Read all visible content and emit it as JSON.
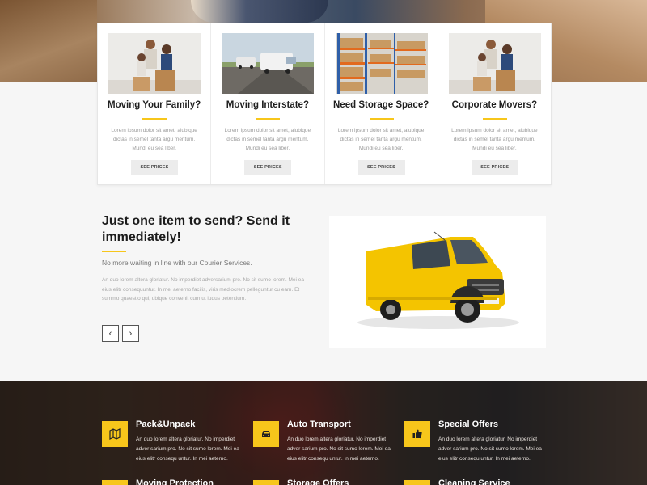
{
  "cards": [
    {
      "title": "Moving Your Family?",
      "desc": "Lorem ipsum dolor sit amet, alubique dictas in semel tanta argu mentum. Mundi eu sea liber.",
      "button": "SEE PRICES",
      "image": "family-with-boxes"
    },
    {
      "title": "Moving Interstate?",
      "desc": "Lorem ipsum dolor sit amet, alubique dictas in semel tanta argu mentum. Mundi eu sea liber.",
      "button": "SEE PRICES",
      "image": "vans-on-road"
    },
    {
      "title": "Need Storage Space?",
      "desc": "Lorem ipsum dolor sit amet, alubique dictas in semel tanta argu mentum. Mundi eu sea liber.",
      "button": "SEE PRICES",
      "image": "warehouse-shelves"
    },
    {
      "title": "Corporate Movers?",
      "desc": "Lorem ipsum dolor sit amet, alubique dictas in semel tanta argu mentum. Mundi eu sea liber.",
      "button": "SEE PRICES",
      "image": "family-with-boxes"
    }
  ],
  "intro": {
    "title": "Just one item to send? Send it immediately!",
    "subtitle": "No more waiting in line with our Courier Services.",
    "body": "An duo lorem altera gloriatur. No imperdiet adversarium pro. No sit sumo lorem. Mei ea eius elitr consequuntur. In mei aeterno facilis, viris mediocrem pelleguntur cu eam. Et summo quaestio qui, ubique convenit cum ut ludus petentium.",
    "prev_glyph": "‹",
    "next_glyph": "›"
  },
  "features": [
    {
      "title": "Pack&Unpack",
      "desc": "An duo lorem altera gloriatur. No imperdiet adver sarium pro. No sit sumo lorem. Mei ea eius elitr consequ untur. In mei aeterno.",
      "icon": "map-icon"
    },
    {
      "title": "Auto Transport",
      "desc": "An duo lorem altera gloriatur. No imperdiet adver sarium pro. No sit sumo lorem. Mei ea eius elitr consequ untur. In mei aeterno.",
      "icon": "car-icon"
    },
    {
      "title": "Special Offers",
      "desc": "An duo lorem altera gloriatur. No imperdiet adver sarium pro. No sit sumo lorem. Mei ea eius elitr consequ untur. In mei aeterno.",
      "icon": "thumbs-up-icon"
    },
    {
      "title": "Moving Protection",
      "icon": "shield-icon"
    },
    {
      "title": "Storage Offers",
      "icon": "box-icon"
    },
    {
      "title": "Cleaning Service",
      "icon": "broom-icon"
    }
  ],
  "colors": {
    "accent": "#f7c61b",
    "dark_band": "#2b211c",
    "background": "#f6f6f6"
  }
}
